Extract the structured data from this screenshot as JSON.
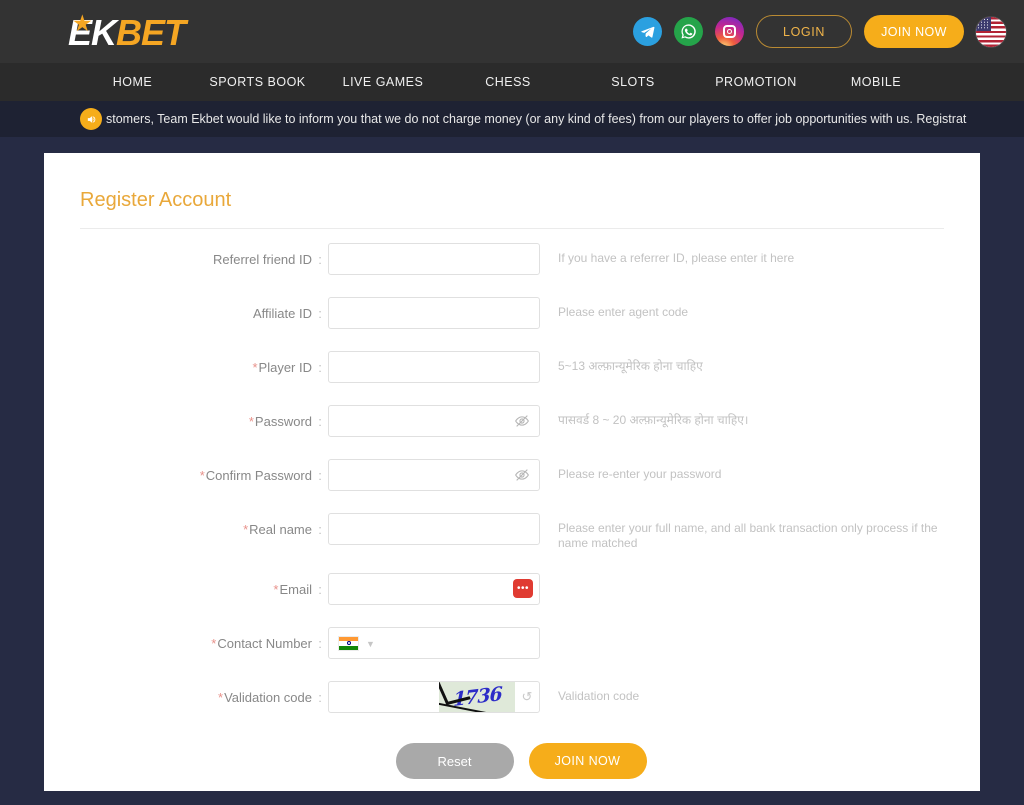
{
  "brand": {
    "logo_ek": "EK",
    "logo_bet": "BET",
    "star_glyph": "★",
    "accent_color": "#f6ad1a",
    "header_bg": "#333333",
    "page_bg": "#262b44"
  },
  "header": {
    "social": [
      {
        "name": "telegram",
        "glyph": "➤"
      },
      {
        "name": "whatsapp",
        "glyph": "✆"
      },
      {
        "name": "instagram",
        "glyph": ""
      }
    ],
    "login_label": "LOGIN",
    "join_label": "JOIN NOW",
    "language_flag": "us-flag"
  },
  "nav": {
    "items": [
      {
        "label": "HOME"
      },
      {
        "label": "SPORTS BOOK"
      },
      {
        "label": "LIVE GAMES"
      },
      {
        "label": "CHESS"
      },
      {
        "label": "SLOTS"
      },
      {
        "label": "PROMOTION"
      },
      {
        "label": "MOBILE"
      }
    ]
  },
  "announcement": {
    "icon": "speaker-icon",
    "icon_glyph": "🔊",
    "text": "stomers, Team Ekbet would like to inform you that we do not charge money (or any kind of fees) from our players to offer job opportunities with us. Registrat"
  },
  "form": {
    "title": "Register Account",
    "colon": ":",
    "required_mark": "*",
    "fields": [
      {
        "label": "Referrel friend ID",
        "required": false,
        "value": "",
        "placeholder": "",
        "hint": "If you have a referrer ID, please enter it here"
      },
      {
        "label": "Affiliate ID",
        "required": false,
        "value": "",
        "placeholder": "",
        "hint": "Please enter agent code"
      },
      {
        "label": "Player ID",
        "required": true,
        "value": "",
        "placeholder": "",
        "hint": "5~13 अल्फ़ान्यूमेरिक होना चाहिए"
      },
      {
        "label": "Password",
        "required": true,
        "value": "",
        "placeholder": "",
        "hint": "पासवर्ड 8 ~ 20 अल्फ़ान्यूमेरिक होना चाहिए।"
      },
      {
        "label": "Confirm Password",
        "required": true,
        "value": "",
        "placeholder": "",
        "hint": "Please re-enter your password"
      },
      {
        "label": "Real name",
        "required": true,
        "value": "",
        "placeholder": "",
        "hint": "Please enter your full name, and all bank transaction only process if the name matched"
      },
      {
        "label": "Email",
        "required": true,
        "value": "",
        "placeholder": "",
        "hint": ""
      },
      {
        "label": "Contact Number",
        "required": true,
        "value": "",
        "placeholder": "",
        "hint": ""
      },
      {
        "label": "Validation code",
        "required": true,
        "value": "",
        "placeholder": "",
        "hint": "Validation code"
      }
    ],
    "country_code_flag": "india-flag",
    "captcha_text": "1736",
    "captcha_refresh_glyph": "↺",
    "email_badge_dots": "•••",
    "reset_label": "Reset",
    "submit_label": "JOIN NOW"
  }
}
